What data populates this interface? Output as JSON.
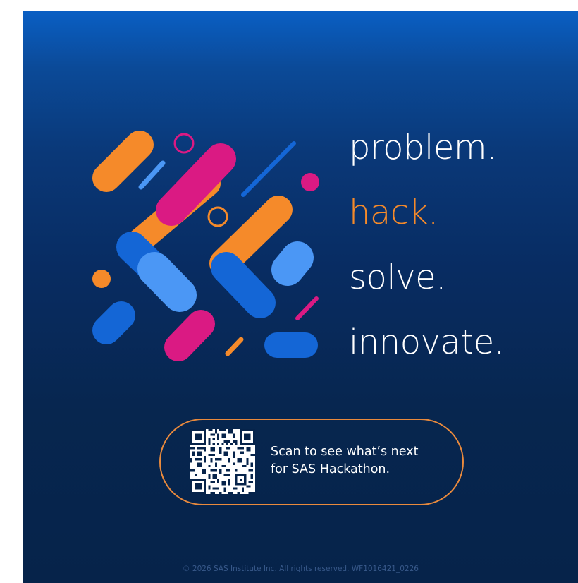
{
  "brand": {
    "colors": {
      "background_top": "#0a5fc4",
      "background_bottom": "#06234a",
      "orange": "#f58a2a",
      "magenta": "#da1a83",
      "blue": "#1466d6",
      "light_blue": "#4b97f5",
      "white": "#ffffff"
    }
  },
  "taglines": [
    {
      "text": "problem.",
      "color": "#ffffff"
    },
    {
      "text": "hack.",
      "color": "#f58a2a"
    },
    {
      "text": "solve.",
      "color": "#ffffff"
    },
    {
      "text": "innovate.",
      "color": "#ffffff"
    }
  ],
  "qr_callout": {
    "line1": "Scan to see what’s next",
    "line2": "for SAS Hackathon.",
    "border_color": "#e98a3d",
    "icon": "qr-code-icon"
  },
  "footer": {
    "copyright": "© 2026 SAS Institute Inc. All rights reserved. WF1016421_0226"
  }
}
